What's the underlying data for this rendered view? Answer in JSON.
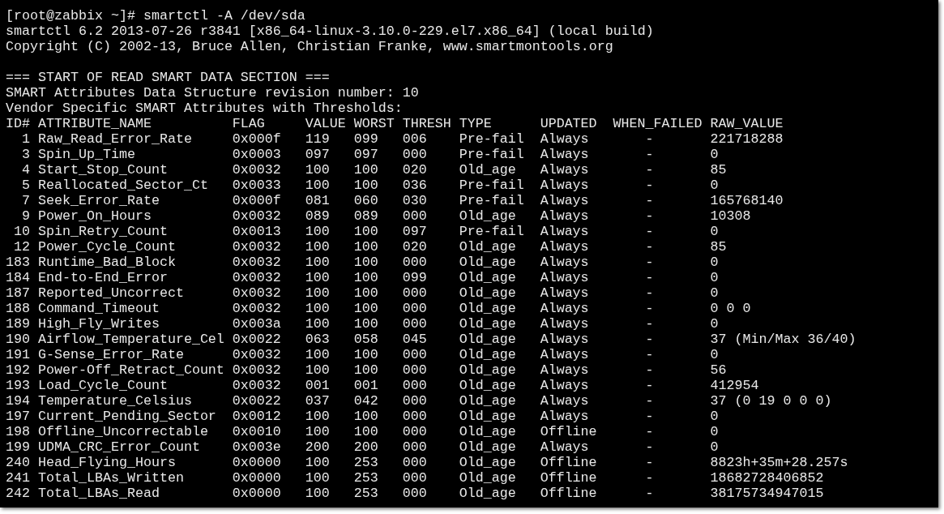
{
  "terminal": {
    "command_line": "[root@zabbix ~]# smartctl -A /dev/sda",
    "output_lines": [
      "smartctl 6.2 2013-07-26 r3841 [x86_64-linux-3.10.0-229.el7.x86_64] (local build)",
      "Copyright (C) 2002-13, Bruce Allen, Christian Franke, www.smartmontools.org"
    ],
    "section_header": "=== START OF READ SMART DATA SECTION ===",
    "info_lines": [
      "SMART Attributes Data Structure revision number: 10",
      "Vendor Specific SMART Attributes with Thresholds:"
    ],
    "table": {
      "columns": [
        "ID#",
        "ATTRIBUTE_NAME",
        "FLAG",
        "VALUE",
        "WORST",
        "THRESH",
        "TYPE",
        "UPDATED",
        "WHEN_FAILED",
        "RAW_VALUE"
      ],
      "rows": [
        [
          "1",
          "Raw_Read_Error_Rate",
          "0x000f",
          "119",
          "099",
          "006",
          "Pre-fail",
          "Always",
          "-",
          "221718288"
        ],
        [
          "3",
          "Spin_Up_Time",
          "0x0003",
          "097",
          "097",
          "000",
          "Pre-fail",
          "Always",
          "-",
          "0"
        ],
        [
          "4",
          "Start_Stop_Count",
          "0x0032",
          "100",
          "100",
          "020",
          "Old_age",
          "Always",
          "-",
          "85"
        ],
        [
          "5",
          "Reallocated_Sector_Ct",
          "0x0033",
          "100",
          "100",
          "036",
          "Pre-fail",
          "Always",
          "-",
          "0"
        ],
        [
          "7",
          "Seek_Error_Rate",
          "0x000f",
          "081",
          "060",
          "030",
          "Pre-fail",
          "Always",
          "-",
          "165768140"
        ],
        [
          "9",
          "Power_On_Hours",
          "0x0032",
          "089",
          "089",
          "000",
          "Old_age",
          "Always",
          "-",
          "10308"
        ],
        [
          "10",
          "Spin_Retry_Count",
          "0x0013",
          "100",
          "100",
          "097",
          "Pre-fail",
          "Always",
          "-",
          "0"
        ],
        [
          "12",
          "Power_Cycle_Count",
          "0x0032",
          "100",
          "100",
          "020",
          "Old_age",
          "Always",
          "-",
          "85"
        ],
        [
          "183",
          "Runtime_Bad_Block",
          "0x0032",
          "100",
          "100",
          "000",
          "Old_age",
          "Always",
          "-",
          "0"
        ],
        [
          "184",
          "End-to-End_Error",
          "0x0032",
          "100",
          "100",
          "099",
          "Old_age",
          "Always",
          "-",
          "0"
        ],
        [
          "187",
          "Reported_Uncorrect",
          "0x0032",
          "100",
          "100",
          "000",
          "Old_age",
          "Always",
          "-",
          "0"
        ],
        [
          "188",
          "Command_Timeout",
          "0x0032",
          "100",
          "100",
          "000",
          "Old_age",
          "Always",
          "-",
          "0 0 0"
        ],
        [
          "189",
          "High_Fly_Writes",
          "0x003a",
          "100",
          "100",
          "000",
          "Old_age",
          "Always",
          "-",
          "0"
        ],
        [
          "190",
          "Airflow_Temperature_Cel",
          "0x0022",
          "063",
          "058",
          "045",
          "Old_age",
          "Always",
          "-",
          "37 (Min/Max 36/40)"
        ],
        [
          "191",
          "G-Sense_Error_Rate",
          "0x0032",
          "100",
          "100",
          "000",
          "Old_age",
          "Always",
          "-",
          "0"
        ],
        [
          "192",
          "Power-Off_Retract_Count",
          "0x0032",
          "100",
          "100",
          "000",
          "Old_age",
          "Always",
          "-",
          "56"
        ],
        [
          "193",
          "Load_Cycle_Count",
          "0x0032",
          "001",
          "001",
          "000",
          "Old_age",
          "Always",
          "-",
          "412954"
        ],
        [
          "194",
          "Temperature_Celsius",
          "0x0022",
          "037",
          "042",
          "000",
          "Old_age",
          "Always",
          "-",
          "37 (0 19 0 0 0)"
        ],
        [
          "197",
          "Current_Pending_Sector",
          "0x0012",
          "100",
          "100",
          "000",
          "Old_age",
          "Always",
          "-",
          "0"
        ],
        [
          "198",
          "Offline_Uncorrectable",
          "0x0010",
          "100",
          "100",
          "000",
          "Old_age",
          "Offline",
          "-",
          "0"
        ],
        [
          "199",
          "UDMA_CRC_Error_Count",
          "0x003e",
          "200",
          "200",
          "000",
          "Old_age",
          "Always",
          "-",
          "0"
        ],
        [
          "240",
          "Head_Flying_Hours",
          "0x0000",
          "100",
          "253",
          "000",
          "Old_age",
          "Offline",
          "-",
          "8823h+35m+28.257s"
        ],
        [
          "241",
          "Total_LBAs_Written",
          "0x0000",
          "100",
          "253",
          "000",
          "Old_age",
          "Offline",
          "-",
          "18682728406852"
        ],
        [
          "242",
          "Total_LBAs_Read",
          "0x0000",
          "100",
          "253",
          "000",
          "Old_age",
          "Offline",
          "-",
          "38175734947015"
        ]
      ]
    }
  }
}
